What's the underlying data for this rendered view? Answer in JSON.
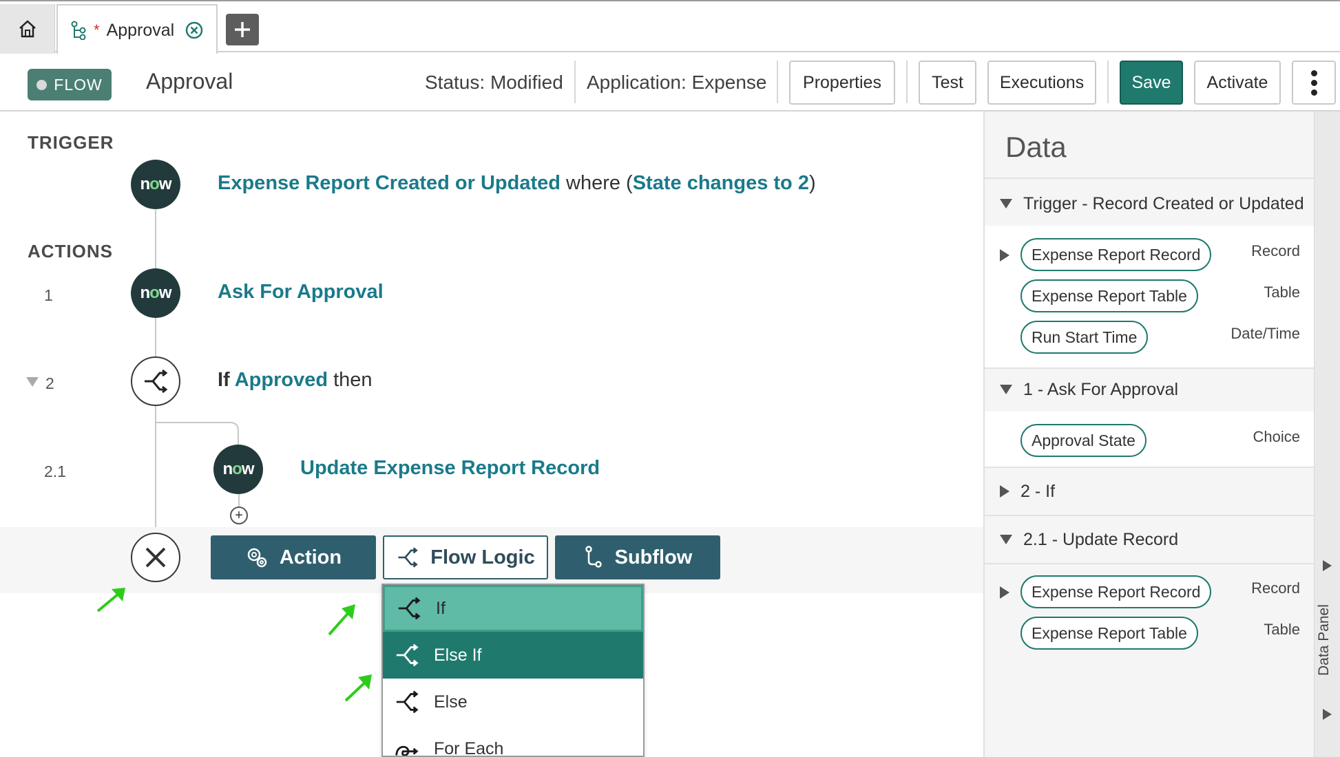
{
  "tabs": {
    "active_label": "Approval",
    "modified_marker": "*"
  },
  "header": {
    "badge": "FLOW",
    "title": "Approval",
    "status": "Status: Modified",
    "application": "Application: Expense",
    "buttons": {
      "properties": "Properties",
      "test": "Test",
      "executions": "Executions",
      "save": "Save",
      "activate": "Activate"
    }
  },
  "canvas": {
    "trigger_label": "TRIGGER",
    "actions_label": "ACTIONS",
    "trigger": {
      "link": "Expense Report Created or Updated",
      "where": " where (",
      "condition": "State changes to 2",
      "close": ")"
    },
    "steps": [
      {
        "number": "1",
        "link": "Ask For Approval"
      },
      {
        "number": "2",
        "prefix": "If ",
        "link": "Approved",
        "suffix": " then"
      },
      {
        "number": "2.1",
        "link": "Update Expense Report Record"
      }
    ],
    "now_logo": {
      "n": "n",
      "o": "o",
      "w": "w"
    },
    "add_buttons": {
      "action": "Action",
      "flow_logic": "Flow Logic",
      "subflow": "Subflow"
    },
    "flow_logic_menu": [
      "If",
      "Else If",
      "Else",
      "For Each"
    ]
  },
  "data_panel": {
    "title": "Data",
    "side_label": "Data Panel",
    "groups": [
      {
        "label": "Trigger - Record Created or Updated",
        "items": [
          {
            "pill": "Expense Report Record",
            "type": "Record"
          },
          {
            "pill": "Expense Report Table",
            "type": "Table"
          },
          {
            "pill": "Run Start Time",
            "type": "Date/Time"
          }
        ]
      },
      {
        "label": "1 - Ask For Approval",
        "items": [
          {
            "pill": "Approval State",
            "type": "Choice"
          }
        ]
      },
      {
        "label": "2 - If",
        "items": []
      },
      {
        "label": "2.1 - Update Record",
        "items": [
          {
            "pill": "Expense Report Record",
            "type": "Record"
          },
          {
            "pill": "Expense Report Table",
            "type": "Table"
          }
        ]
      }
    ]
  },
  "colors": {
    "accent": "#1f7a6d",
    "link": "#1a7a8a",
    "button_dark": "#2f5f6e",
    "menu_hover": "#5fbaa6",
    "annotation_arrow": "#2ecc1a"
  }
}
